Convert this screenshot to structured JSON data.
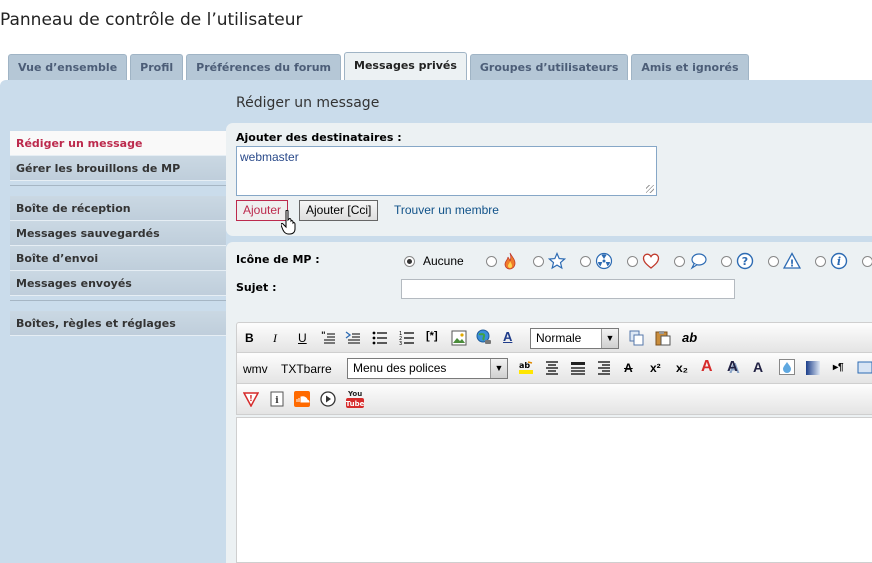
{
  "page_title": "Panneau de contrôle de l’utilisateur",
  "tabs": [
    {
      "label": "Vue d’ensemble",
      "active": false
    },
    {
      "label": "Profil",
      "active": false
    },
    {
      "label": "Préférences du forum",
      "active": false
    },
    {
      "label": "Messages privés",
      "active": true
    },
    {
      "label": "Groupes d’utilisateurs",
      "active": false
    },
    {
      "label": "Amis et ignorés",
      "active": false
    }
  ],
  "sidebar": {
    "group1": [
      "Rédiger un message",
      "Gérer les brouillons de MP"
    ],
    "group2": [
      "Boîte de réception",
      "Messages sauvegardés",
      "Boîte d’envoi",
      "Messages envoyés"
    ],
    "group3": [
      "Boîtes, règles et réglages"
    ]
  },
  "content": {
    "title": "Rédiger un message",
    "recipients_label": "Ajouter des destinataires :",
    "recipients_value": "webmaster",
    "add_button": "Ajouter",
    "add_bcc_button": "Ajouter [Cci]",
    "find_member_link": "Trouver un membre",
    "icon_label": "Icône de MP :",
    "icon_none": "Aucune",
    "subject_label": "Sujet :",
    "subject_value": ""
  },
  "toolbar": {
    "row1_size_select": "Normale",
    "row2_wmv": "wmv",
    "row2_txtbarre": "TXTbarre",
    "row2_font_select": "Menu des polices"
  },
  "colors": {
    "panel_bg": "#cadceb",
    "box_bg": "#ecf1f3",
    "active_red": "#bc2a4d",
    "link_blue": "#105289"
  }
}
